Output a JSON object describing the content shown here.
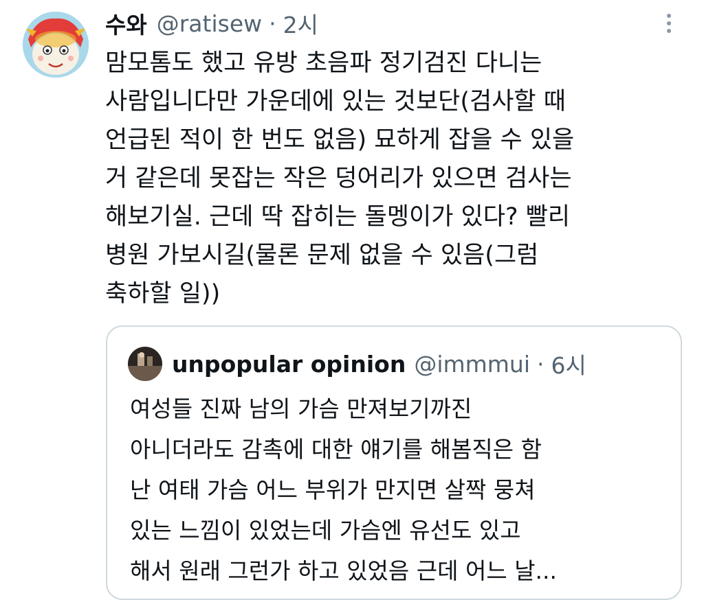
{
  "tweet": {
    "author_name": "수와",
    "handle": "@ratisew",
    "separator": "·",
    "time": "2시",
    "more_icon": "more-vertical-icon",
    "avatar_icon": "cartoon-character-avatar",
    "lines": [
      "맘모톰도 했고 유방 초음파 정기검진 다니는",
      "사람입니다만 가운데에 있는 것보단(검사할 때",
      "언급된 적이 한 번도 없음) 묘하게 잡을 수 있을",
      "거 같은데 못잡는 작은 덩어리가 있으면 검사는",
      "해보기실. 근데 딱 잡히는 돌멩이가 있다? 빨리",
      "병원 가보시길(물론 문제 없을 수 있음(그럼",
      "축하할 일))"
    ]
  },
  "quote": {
    "author_name": "unpopular opinion",
    "handle": "@immmui",
    "separator": "·",
    "time": "6시",
    "avatar_icon": "photo-avatar",
    "lines": [
      "여성들 진짜 남의 가슴 만져보기까진",
      "아니더라도 감촉에 대한 얘기를 해봄직은 함",
      "난 여태 가슴 어느 부위가 만지면 살짝 뭉쳐",
      "있는 느낌이 있었는데 가슴엔 유선도 있고",
      "해서 원래 그런가 하고 있었음 근데 어느 날..."
    ]
  },
  "colors": {
    "text": "#0f1419",
    "secondary": "#536471",
    "border": "#cfd9de",
    "icon": "#8b98a5"
  }
}
